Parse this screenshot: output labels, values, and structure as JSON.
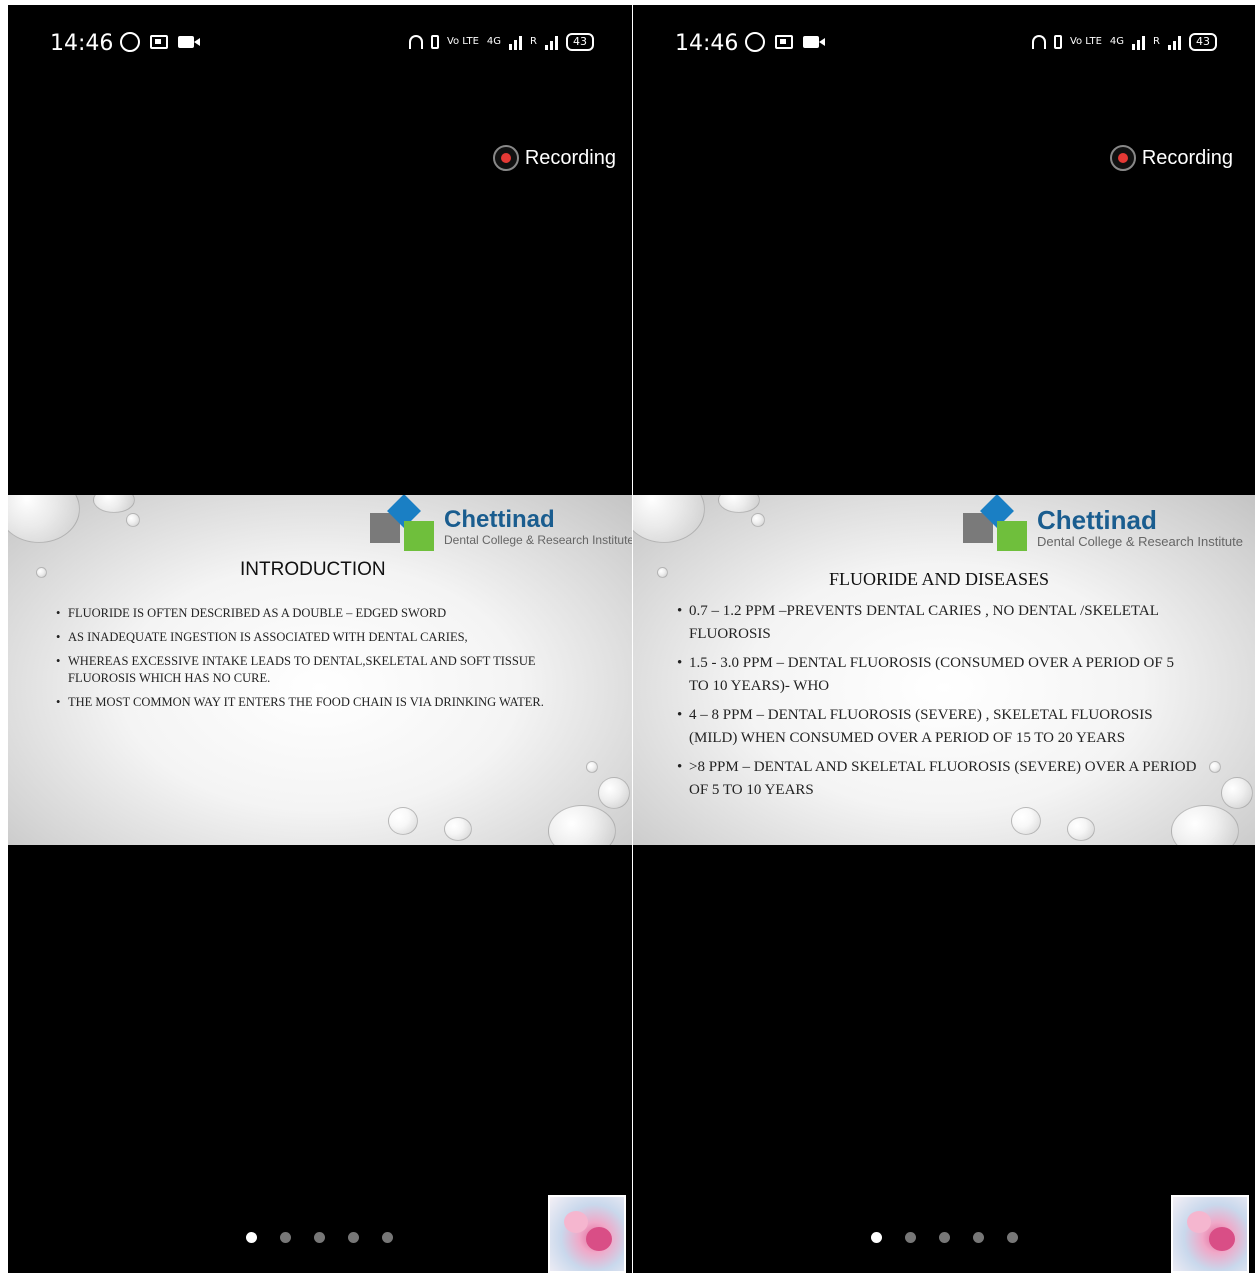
{
  "status_bar": {
    "time": "14:46",
    "volte": "Vo LTE",
    "network": "4G",
    "roaming": "R",
    "battery": "43"
  },
  "recording_label": "Recording",
  "logo": {
    "name": "Chettinad",
    "subtitle": "Dental College & Research Institute"
  },
  "slide_left": {
    "title": "INTRODUCTION",
    "bullets": [
      "FLUORIDE  IS OFTEN DESCRIBED AS A DOUBLE – EDGED SWORD",
      "AS INADEQUATE INGESTION IS ASSOCIATED WITH DENTAL CARIES,",
      "WHEREAS EXCESSIVE INTAKE LEADS TO DENTAL,SKELETAL AND SOFT TISSUE FLUOROSIS WHICH HAS NO CURE.",
      "THE MOST COMMON WAY IT ENTERS THE FOOD CHAIN IS VIA DRINKING WATER."
    ]
  },
  "slide_right": {
    "title": "FLUORIDE  AND DISEASES",
    "bullets": [
      "0.7 – 1.2 PPM  –PREVENTS DENTAL CARIES , NO DENTAL /SKELETAL FLUOROSIS",
      "1.5 - 3.0 PPM – DENTAL FLUOROSIS (CONSUMED OVER A PERIOD OF 5 TO 10 YEARS)- WHO",
      "4 – 8 PPM – DENTAL FLUOROSIS (SEVERE)  , SKELETAL FLUOROSIS (MILD) WHEN CONSUMED OVER A PERIOD OF 15 TO 20 YEARS",
      ">8 PPM – DENTAL AND SKELETAL FLUOROSIS (SEVERE)  OVER A PERIOD OF 5 TO 10 YEARS"
    ]
  },
  "pager": {
    "total": 5,
    "current": 1
  },
  "icons": {
    "status_left": [
      "whatsapp-icon",
      "screenshot-icon",
      "video-call-icon"
    ],
    "status_right": [
      "headset-icon",
      "vibrate-icon",
      "signal-icon",
      "battery-icon"
    ],
    "recording": "record-dot-icon"
  },
  "colors": {
    "recording_dot": "#e53935",
    "logo_blue": "#1a5d8f",
    "logo_green": "#6fbf3c"
  }
}
